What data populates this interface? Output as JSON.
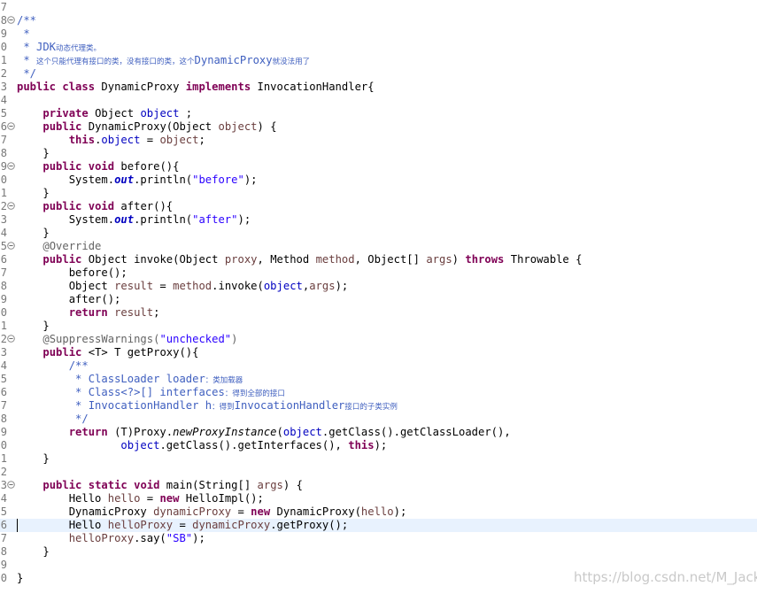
{
  "editor": {
    "lines": [
      {
        "n": "7",
        "fold": "",
        "segs": []
      },
      {
        "n": "8",
        "fold": "minus",
        "segs": [
          [
            "cm",
            "/**"
          ]
        ]
      },
      {
        "n": "9",
        "fold": "",
        "segs": [
          [
            "cm",
            " *"
          ]
        ]
      },
      {
        "n": "0",
        "fold": "",
        "segs": [
          [
            "cm",
            " * JDK"
          ],
          [
            "cm cjk",
            "动态代理类。"
          ]
        ]
      },
      {
        "n": "1",
        "fold": "",
        "segs": [
          [
            "cm",
            " * "
          ],
          [
            "cm cjk",
            "这个只能代理有接口的类，没有接口的类，这个"
          ],
          [
            "cm",
            "DynamicProxy"
          ],
          [
            "cm cjk",
            "就没法用了"
          ]
        ]
      },
      {
        "n": "2",
        "fold": "",
        "segs": [
          [
            "cm",
            " */"
          ]
        ]
      },
      {
        "n": "3",
        "fold": "",
        "segs": [
          [
            "kw",
            "public"
          ],
          [
            "",
            " "
          ],
          [
            "kw",
            "class"
          ],
          [
            "",
            " DynamicProxy "
          ],
          [
            "kw",
            "implements"
          ],
          [
            "",
            " InvocationHandler{"
          ]
        ]
      },
      {
        "n": "4",
        "fold": "",
        "segs": []
      },
      {
        "n": "5",
        "fold": "",
        "segs": [
          [
            "",
            "    "
          ],
          [
            "kw",
            "private"
          ],
          [
            "",
            " Object "
          ],
          [
            "fld",
            "object"
          ],
          [
            "",
            " ;"
          ]
        ]
      },
      {
        "n": "6",
        "fold": "minus",
        "segs": [
          [
            "",
            "    "
          ],
          [
            "kw",
            "public"
          ],
          [
            "",
            " DynamicProxy(Object "
          ],
          [
            "var",
            "object"
          ],
          [
            "",
            ") {"
          ]
        ]
      },
      {
        "n": "7",
        "fold": "",
        "segs": [
          [
            "",
            "        "
          ],
          [
            "kw",
            "this"
          ],
          [
            "",
            "."
          ],
          [
            "fld",
            "object"
          ],
          [
            "",
            " = "
          ],
          [
            "var",
            "object"
          ],
          [
            "",
            ";"
          ]
        ]
      },
      {
        "n": "8",
        "fold": "",
        "segs": [
          [
            "",
            "    }"
          ]
        ]
      },
      {
        "n": "9",
        "fold": "minus",
        "segs": [
          [
            "",
            "    "
          ],
          [
            "kw",
            "public"
          ],
          [
            "",
            " "
          ],
          [
            "kw",
            "void"
          ],
          [
            "",
            " before(){"
          ]
        ]
      },
      {
        "n": "0",
        "fold": "",
        "segs": [
          [
            "",
            "        System."
          ],
          [
            "sfld",
            "out"
          ],
          [
            "",
            ".println("
          ],
          [
            "str",
            "\"before\""
          ],
          [
            "",
            ");"
          ]
        ]
      },
      {
        "n": "1",
        "fold": "",
        "segs": [
          [
            "",
            "    }"
          ]
        ]
      },
      {
        "n": "2",
        "fold": "minus",
        "segs": [
          [
            "",
            "    "
          ],
          [
            "kw",
            "public"
          ],
          [
            "",
            " "
          ],
          [
            "kw",
            "void"
          ],
          [
            "",
            " after(){"
          ]
        ]
      },
      {
        "n": "3",
        "fold": "",
        "segs": [
          [
            "",
            "        System."
          ],
          [
            "sfld",
            "out"
          ],
          [
            "",
            ".println("
          ],
          [
            "str",
            "\"after\""
          ],
          [
            "",
            ");"
          ]
        ]
      },
      {
        "n": "4",
        "fold": "",
        "segs": [
          [
            "",
            "    }"
          ]
        ]
      },
      {
        "n": "5",
        "fold": "minus",
        "segs": [
          [
            "",
            "    "
          ],
          [
            "ann",
            "@Override"
          ]
        ]
      },
      {
        "n": "6",
        "fold": "",
        "segs": [
          [
            "",
            "    "
          ],
          [
            "kw",
            "public"
          ],
          [
            "",
            " Object invoke(Object "
          ],
          [
            "var",
            "proxy"
          ],
          [
            "",
            ", Method "
          ],
          [
            "var",
            "method"
          ],
          [
            "",
            ", Object[] "
          ],
          [
            "var",
            "args"
          ],
          [
            "",
            ") "
          ],
          [
            "kw",
            "throws"
          ],
          [
            "",
            " Throwable {"
          ]
        ]
      },
      {
        "n": "7",
        "fold": "",
        "segs": [
          [
            "",
            "        before();"
          ]
        ]
      },
      {
        "n": "8",
        "fold": "",
        "segs": [
          [
            "",
            "        Object "
          ],
          [
            "var",
            "result"
          ],
          [
            "",
            " = "
          ],
          [
            "var",
            "method"
          ],
          [
            "",
            ".invoke("
          ],
          [
            "fld",
            "object"
          ],
          [
            "",
            ","
          ],
          [
            "var",
            "args"
          ],
          [
            "",
            ");"
          ]
        ]
      },
      {
        "n": "9",
        "fold": "",
        "segs": [
          [
            "",
            "        after();"
          ]
        ]
      },
      {
        "n": "0",
        "fold": "",
        "segs": [
          [
            "",
            "        "
          ],
          [
            "kw",
            "return"
          ],
          [
            "",
            " "
          ],
          [
            "var",
            "result"
          ],
          [
            "",
            ";"
          ]
        ]
      },
      {
        "n": "1",
        "fold": "",
        "segs": [
          [
            "",
            "    }"
          ]
        ]
      },
      {
        "n": "2",
        "fold": "minus",
        "segs": [
          [
            "",
            "    "
          ],
          [
            "ann",
            "@SuppressWarnings("
          ],
          [
            "str",
            "\"unchecked\""
          ],
          [
            "ann",
            ")"
          ]
        ]
      },
      {
        "n": "3",
        "fold": "",
        "segs": [
          [
            "",
            "    "
          ],
          [
            "kw",
            "public"
          ],
          [
            "",
            " <T> T getProxy(){"
          ]
        ]
      },
      {
        "n": "4",
        "fold": "",
        "segs": [
          [
            "",
            "        "
          ],
          [
            "cm",
            "/**"
          ]
        ]
      },
      {
        "n": "5",
        "fold": "",
        "segs": [
          [
            "",
            "         "
          ],
          [
            "cm",
            "* ClassLoader loader"
          ],
          [
            "cm cjk",
            "：类加载器"
          ]
        ]
      },
      {
        "n": "6",
        "fold": "",
        "segs": [
          [
            "",
            "         "
          ],
          [
            "cm",
            "* Class<?>[] interfaces"
          ],
          [
            "cm cjk",
            "：得到全部的接口"
          ]
        ]
      },
      {
        "n": "7",
        "fold": "",
        "segs": [
          [
            "",
            "         "
          ],
          [
            "cm",
            "* InvocationHandler h"
          ],
          [
            "cm cjk",
            "：得到"
          ],
          [
            "cm",
            "InvocationHandler"
          ],
          [
            "cm cjk",
            "接口的子类实例"
          ]
        ]
      },
      {
        "n": "8",
        "fold": "",
        "segs": [
          [
            "",
            "         "
          ],
          [
            "cm",
            "*/"
          ]
        ]
      },
      {
        "n": "9",
        "fold": "",
        "segs": [
          [
            "",
            "        "
          ],
          [
            "kw",
            "return"
          ],
          [
            "",
            " (T)Proxy."
          ],
          [
            "smeth",
            "newProxyInstance"
          ],
          [
            "",
            "("
          ],
          [
            "fld",
            "object"
          ],
          [
            "",
            ".getClass().getClassLoader(),"
          ]
        ]
      },
      {
        "n": "0",
        "fold": "",
        "segs": [
          [
            "",
            "                "
          ],
          [
            "fld",
            "object"
          ],
          [
            "",
            ".getClass().getInterfaces(), "
          ],
          [
            "kw",
            "this"
          ],
          [
            "",
            ");"
          ]
        ]
      },
      {
        "n": "1",
        "fold": "",
        "segs": [
          [
            "",
            "    }"
          ]
        ]
      },
      {
        "n": "2",
        "fold": "",
        "segs": []
      },
      {
        "n": "3",
        "fold": "minus",
        "segs": [
          [
            "",
            "    "
          ],
          [
            "kw",
            "public"
          ],
          [
            "",
            " "
          ],
          [
            "kw",
            "static"
          ],
          [
            "",
            " "
          ],
          [
            "kw",
            "void"
          ],
          [
            "",
            " main(String[] "
          ],
          [
            "var",
            "args"
          ],
          [
            "",
            ") {"
          ]
        ]
      },
      {
        "n": "4",
        "fold": "",
        "segs": [
          [
            "",
            "        Hello "
          ],
          [
            "var",
            "hello"
          ],
          [
            "",
            " = "
          ],
          [
            "kw",
            "new"
          ],
          [
            "",
            " HelloImpl();"
          ]
        ]
      },
      {
        "n": "5",
        "fold": "",
        "segs": [
          [
            "",
            "        DynamicProxy "
          ],
          [
            "var",
            "dynamicProxy"
          ],
          [
            "",
            " = "
          ],
          [
            "kw",
            "new"
          ],
          [
            "",
            " DynamicProxy("
          ],
          [
            "var",
            "hello"
          ],
          [
            "",
            ");"
          ]
        ]
      },
      {
        "n": "6",
        "fold": "",
        "current": true,
        "segs": [
          [
            "",
            "        Hello "
          ],
          [
            "var",
            "helloProxy"
          ],
          [
            "",
            " = "
          ],
          [
            "var",
            "dynamicProxy"
          ],
          [
            "",
            ".getProxy();"
          ]
        ]
      },
      {
        "n": "7",
        "fold": "",
        "segs": [
          [
            "",
            "        "
          ],
          [
            "var",
            "helloProxy"
          ],
          [
            "",
            ".say("
          ],
          [
            "str",
            "\"SB\""
          ],
          [
            "",
            ");"
          ]
        ]
      },
      {
        "n": "8",
        "fold": "",
        "segs": [
          [
            "",
            "    }"
          ]
        ]
      },
      {
        "n": "9",
        "fold": "",
        "segs": []
      },
      {
        "n": "0",
        "fold": "",
        "segs": [
          [
            "",
            "}"
          ]
        ]
      }
    ]
  },
  "watermark": "https://blog.csdn.net/M_Jack",
  "colors": {
    "keyword": "#7f0055",
    "field": "#0000c0",
    "string": "#2a00ff",
    "comment": "#3f5fbf",
    "annotation": "#646464",
    "local_variable": "#6a3e3e",
    "current_line": "#e8f2fe"
  },
  "icons": {
    "fold": "fold-collapse-icon"
  }
}
